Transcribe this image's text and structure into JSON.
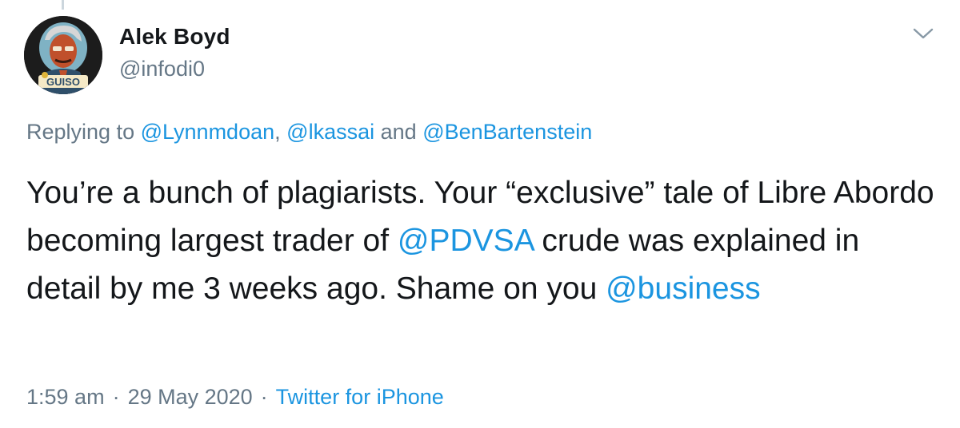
{
  "author": {
    "name": "Alek Boyd",
    "handle": "@infodi0",
    "avatar_badge": "GUISO"
  },
  "reply": {
    "prefix": "Replying to",
    "mention_1": "@Lynnmdoan",
    "comma": ",",
    "mention_2": "@lkassai",
    "and": "and",
    "mention_3": "@BenBartenstein"
  },
  "tweet": {
    "text_1": "You’re a bunch of plagiarists. Your “exclusive” tale of Libre Abordo becoming largest trader of ",
    "mention_pdvsa": "@PDVSA",
    "text_2": " crude was explained in detail by me 3 weeks ago. Shame on you ",
    "mention_business": "@business"
  },
  "meta": {
    "time": "1:59 am",
    "dot": "·",
    "date": "29 May 2020",
    "source": "Twitter for iPhone"
  },
  "colors": {
    "link": "#1b95e0",
    "secondary_text": "#657786",
    "primary_text": "#14171a"
  }
}
